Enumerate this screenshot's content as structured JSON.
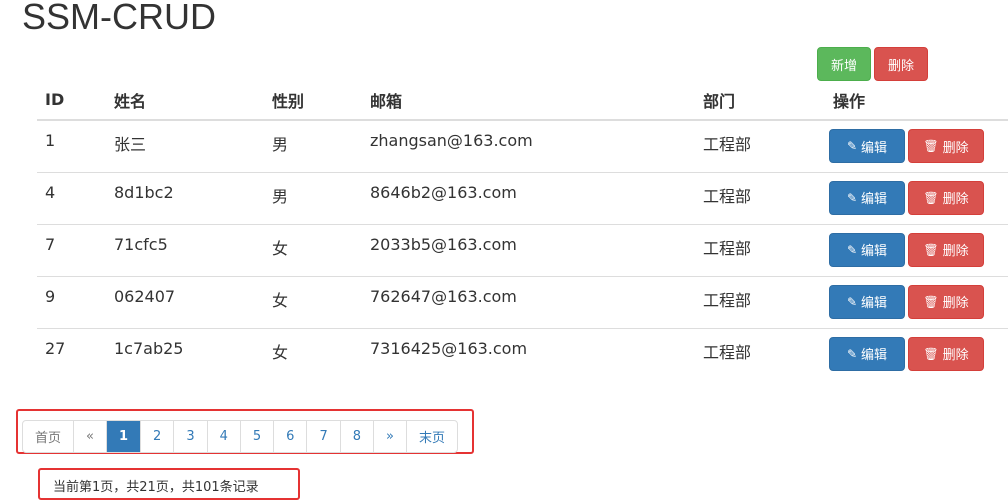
{
  "page": {
    "title": "SSM-CRUD"
  },
  "toolbar": {
    "add_label": "新增",
    "delete_label": "删除"
  },
  "table": {
    "headers": [
      "ID",
      "姓名",
      "性别",
      "邮箱",
      "部门",
      "操作"
    ],
    "rows": [
      {
        "id": "1",
        "name": "张三",
        "gender": "男",
        "email": "zhangsan@163.com",
        "dept": "工程部"
      },
      {
        "id": "4",
        "name": "8d1bc2",
        "gender": "男",
        "email": "8646b2@163.com",
        "dept": "工程部"
      },
      {
        "id": "7",
        "name": "71cfc5",
        "gender": "女",
        "email": "2033b5@163.com",
        "dept": "工程部"
      },
      {
        "id": "9",
        "name": "062407",
        "gender": "女",
        "email": "762647@163.com",
        "dept": "工程部"
      },
      {
        "id": "27",
        "name": "1c7ab25",
        "gender": "女",
        "email": "7316425@163.com",
        "dept": "工程部"
      }
    ],
    "edit_label": "编辑",
    "delete_label": "删除"
  },
  "pagination": {
    "first": "首页",
    "prev": "«",
    "pages": [
      "1",
      "2",
      "3",
      "4",
      "5",
      "6",
      "7",
      "8"
    ],
    "next": "»",
    "last": "末页",
    "active": "1"
  },
  "info": "当前第1页，共21页，共101条记录",
  "colors": {
    "primary": "#337ab7",
    "success": "#5cb85c",
    "danger": "#d9534f",
    "highlight": "#e53333"
  },
  "icons": {
    "edit": "pencil-icon",
    "delete": "trash-icon"
  }
}
